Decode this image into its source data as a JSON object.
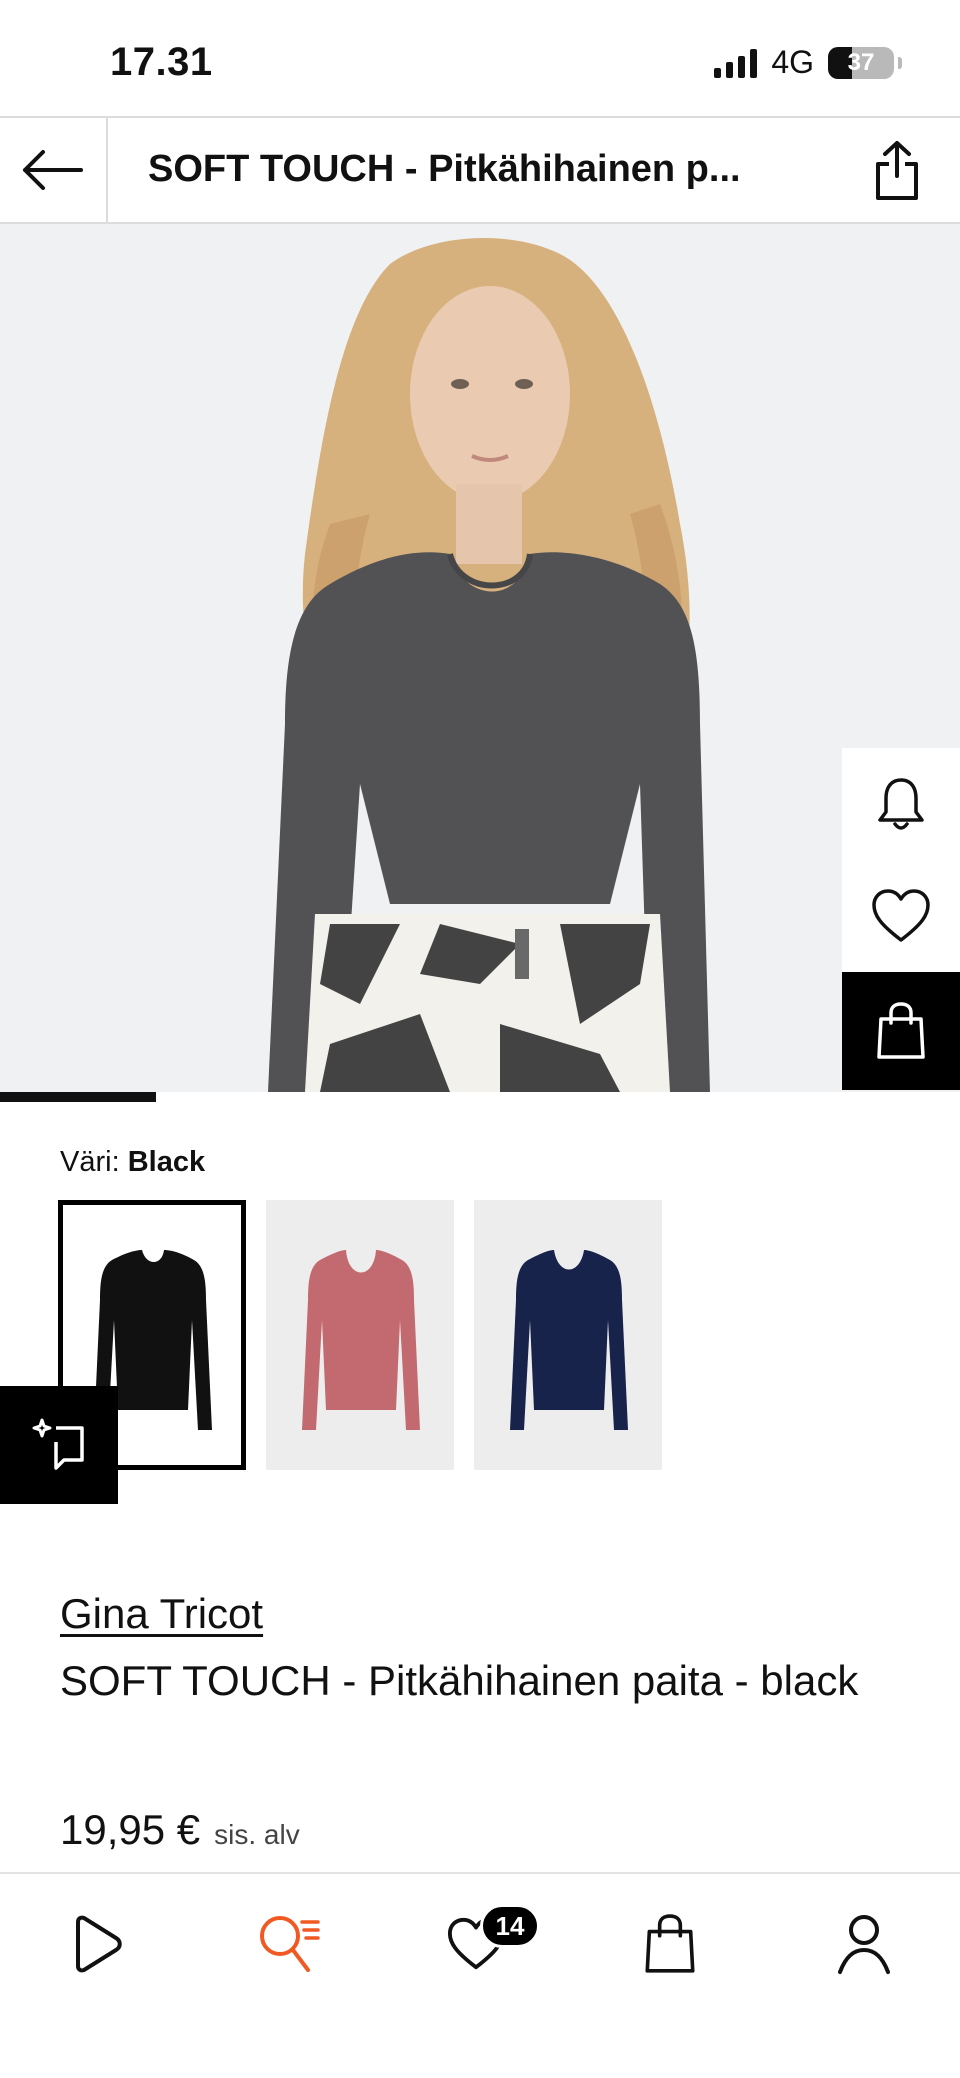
{
  "status_bar": {
    "time": "17.31",
    "network": "4G",
    "battery": "37",
    "battery_level_percent": 37
  },
  "header": {
    "title": "SOFT TOUCH  - Pitkähihainen p...",
    "back_icon": "arrow-left-icon",
    "share_icon": "share-icon"
  },
  "gallery": {
    "image_alt_icon": "product-photo",
    "progress_fraction": 0.2
  },
  "float_actions": {
    "notify_icon": "bell-icon",
    "wishlist_icon": "heart-icon",
    "cart_icon": "shopping-bag-icon"
  },
  "color": {
    "label": "Väri:",
    "selected": "Black",
    "swatches": [
      {
        "color": "#111111"
      },
      {
        "color": "#c26a6f"
      },
      {
        "color": "#17234a"
      }
    ]
  },
  "compare_icon": "compare-sparkle-icon",
  "product": {
    "brand": "Gina Tricot",
    "name": "SOFT TOUCH  - Pitkähihainen paita - black",
    "price": "19,95 €",
    "vat": "sis. alv"
  },
  "bottom_nav": {
    "items": [
      {
        "icon": "play-icon"
      },
      {
        "icon": "search-icon",
        "active_color": "#f05a22"
      },
      {
        "icon": "heart-icon",
        "badge": "14"
      },
      {
        "icon": "bag-icon"
      },
      {
        "icon": "profile-icon"
      }
    ]
  }
}
